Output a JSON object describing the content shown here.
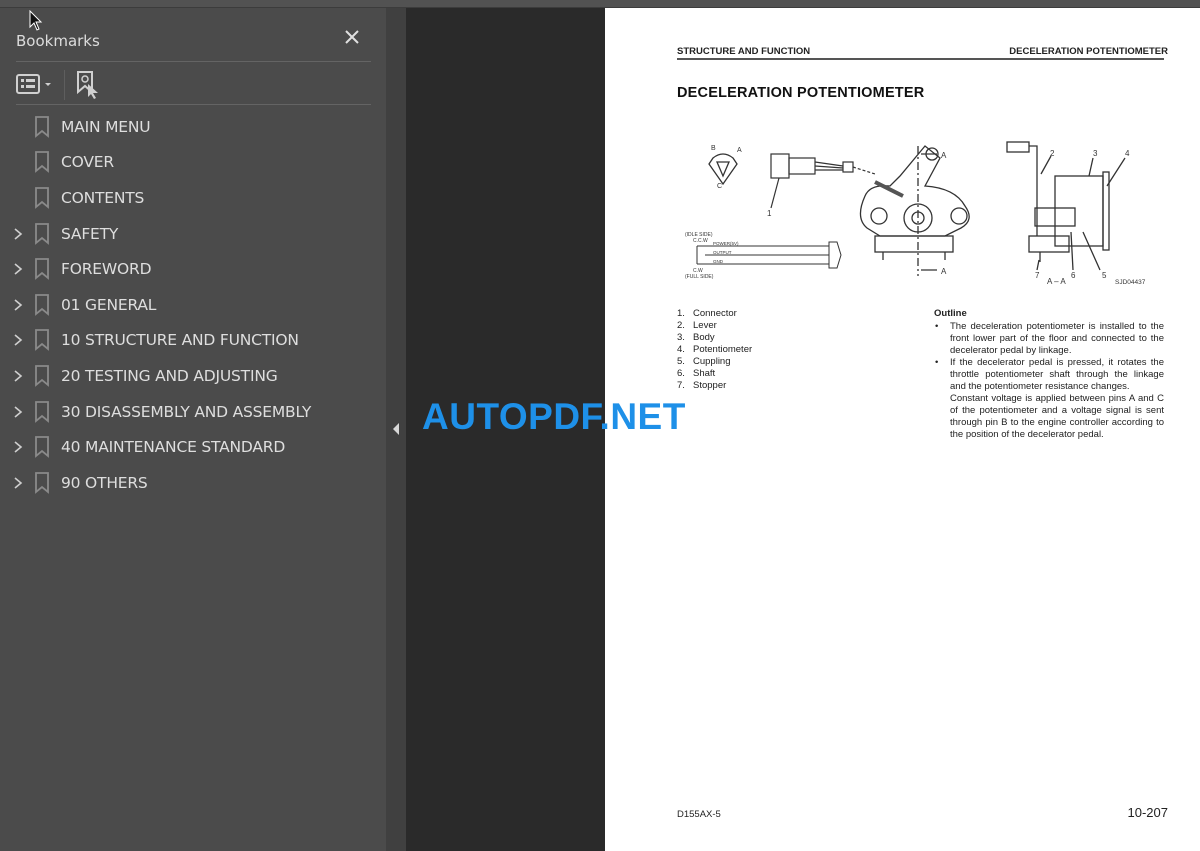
{
  "sidebar": {
    "title": "Bookmarks",
    "close_icon": "close-icon",
    "tools": {
      "options_icon": "list-options-icon",
      "find_icon": "find-current-bookmark-icon"
    },
    "items": [
      {
        "label": "MAIN MENU",
        "expandable": false
      },
      {
        "label": "COVER",
        "expandable": false
      },
      {
        "label": "CONTENTS",
        "expandable": false
      },
      {
        "label": "SAFETY",
        "expandable": true
      },
      {
        "label": "FOREWORD",
        "expandable": true
      },
      {
        "label": "01 GENERAL",
        "expandable": true
      },
      {
        "label": "10 STRUCTURE AND FUNCTION",
        "expandable": true
      },
      {
        "label": "20 TESTING AND ADJUSTING",
        "expandable": true
      },
      {
        "label": "30 DISASSEMBLY AND ASSEMBLY",
        "expandable": true
      },
      {
        "label": "40 MAINTENANCE STANDARD",
        "expandable": true
      },
      {
        "label": "90 OTHERS",
        "expandable": true
      }
    ]
  },
  "page": {
    "header_left": "STRUCTURE AND FUNCTION",
    "header_right": "DECELERATION POTENTIOMETER",
    "title": "DECELERATION POTENTIOMETER",
    "diagram": {
      "section_label": "A",
      "section_caption": "A – A",
      "drawing_code": "SJD04437",
      "pin_labels": [
        "A",
        "B",
        "C"
      ],
      "wiring": {
        "idle_side": "(IDLE SIDE)",
        "ccw": "C.C.W",
        "cw": "C.W",
        "full_side": "(FULL SIDE)",
        "lines": [
          "POWER(5V)",
          "OUTPUT",
          "GND"
        ]
      },
      "callouts": [
        "1",
        "2",
        "3",
        "4",
        "5",
        "6",
        "7"
      ]
    },
    "parts": [
      {
        "num": "1.",
        "name": "Connector"
      },
      {
        "num": "2.",
        "name": "Lever"
      },
      {
        "num": "3.",
        "name": "Body"
      },
      {
        "num": "4.",
        "name": "Potentiometer"
      },
      {
        "num": "5.",
        "name": "Cuppling"
      },
      {
        "num": "6.",
        "name": "Shaft"
      },
      {
        "num": "7.",
        "name": "Stopper"
      }
    ],
    "outline": {
      "heading": "Outline",
      "bullets": [
        "The deceleration potentiometer is installed to the front lower part of the floor and connected to the decelerator pedal by linkage.",
        "If the decelerator pedal is pressed, it rotates the throttle potentiometer shaft through the linkage and the potentiometer resistance changes."
      ],
      "continuation": "Constant voltage is applied between pins A and C of the potentiometer and a voltage signal is sent through pin B to the engine controller according to the position of the decelerator pedal."
    },
    "footer_left": "D155AX-5",
    "footer_right": "10-207"
  },
  "watermark": "AUTOPDF.NET",
  "colors": {
    "sidebar_bg": "#4b4b4b",
    "viewer_bg": "#2a2a2a",
    "watermark": "#1e90e8"
  }
}
